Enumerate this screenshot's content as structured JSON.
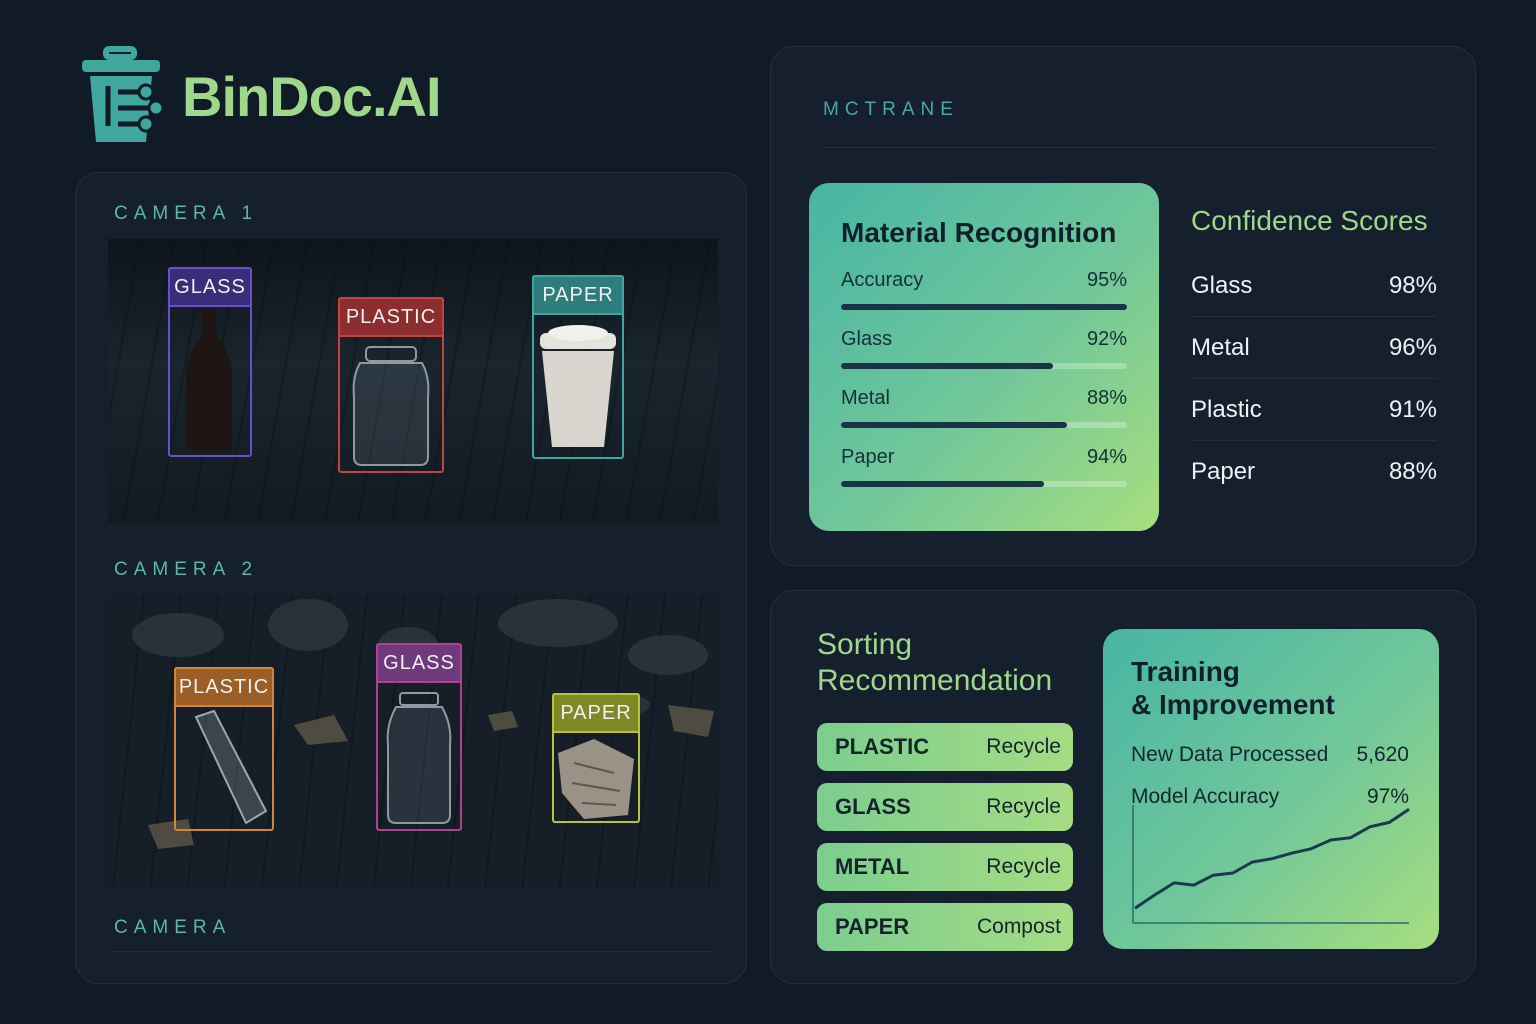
{
  "brand": {
    "name": "BinDoc.AI"
  },
  "cameras": [
    {
      "label": "CAMERA 1",
      "detections": [
        {
          "label": "GLASS",
          "color": "#6b4fc9"
        },
        {
          "label": "PLASTIC",
          "color": "#c5423f"
        },
        {
          "label": "PAPER",
          "color": "#3ea5a3"
        }
      ]
    },
    {
      "label": "CAMERA 2",
      "detections": [
        {
          "label": "PLASTIC",
          "color": "#d28437"
        },
        {
          "label": "GLASS",
          "color": "#b23f8f"
        },
        {
          "label": "PAPER",
          "color": "#b6c43a"
        }
      ]
    },
    {
      "label": "CAMERA"
    }
  ],
  "top_panel": {
    "header": "MCTRANE"
  },
  "material_recognition": {
    "title": "Material Recognition",
    "rows": [
      {
        "label": "Accuracy",
        "value": "95%",
        "fill": 1.0
      },
      {
        "label": "Glass",
        "value": "92%",
        "fill": 0.74
      },
      {
        "label": "Metal",
        "value": "88%",
        "fill": 0.79
      },
      {
        "label": "Paper",
        "value": "94%",
        "fill": 0.71
      }
    ]
  },
  "confidence_scores": {
    "title": "Confidence Scores",
    "rows": [
      {
        "label": "Glass",
        "value": "98%"
      },
      {
        "label": "Metal",
        "value": "96%"
      },
      {
        "label": "Plastic",
        "value": "91%"
      },
      {
        "label": "Paper",
        "value": "88%"
      }
    ]
  },
  "sorting": {
    "title": "Sorting Recommendation",
    "items": [
      {
        "material": "PLASTIC",
        "action": "Recycle"
      },
      {
        "material": "GLASS",
        "action": "Recycle"
      },
      {
        "material": "METAL",
        "action": "Recycle"
      },
      {
        "material": "PAPER",
        "action": "Compost"
      }
    ]
  },
  "training": {
    "title_line1": "Training",
    "title_line2": "& Improvement",
    "new_data_label": "New Data Processed",
    "new_data_value": "5,620",
    "model_accuracy_label": "Model Accuracy",
    "model_accuracy_value": "97%",
    "trend": [
      0.08,
      0.2,
      0.31,
      0.29,
      0.38,
      0.4,
      0.5,
      0.53,
      0.58,
      0.62,
      0.7,
      0.72,
      0.82,
      0.86,
      0.98
    ]
  },
  "colors": {
    "accent_green": "#9fd88a",
    "accent_teal": "#5bb8a6",
    "bg": "#111a27",
    "panel": "#151f2d"
  }
}
